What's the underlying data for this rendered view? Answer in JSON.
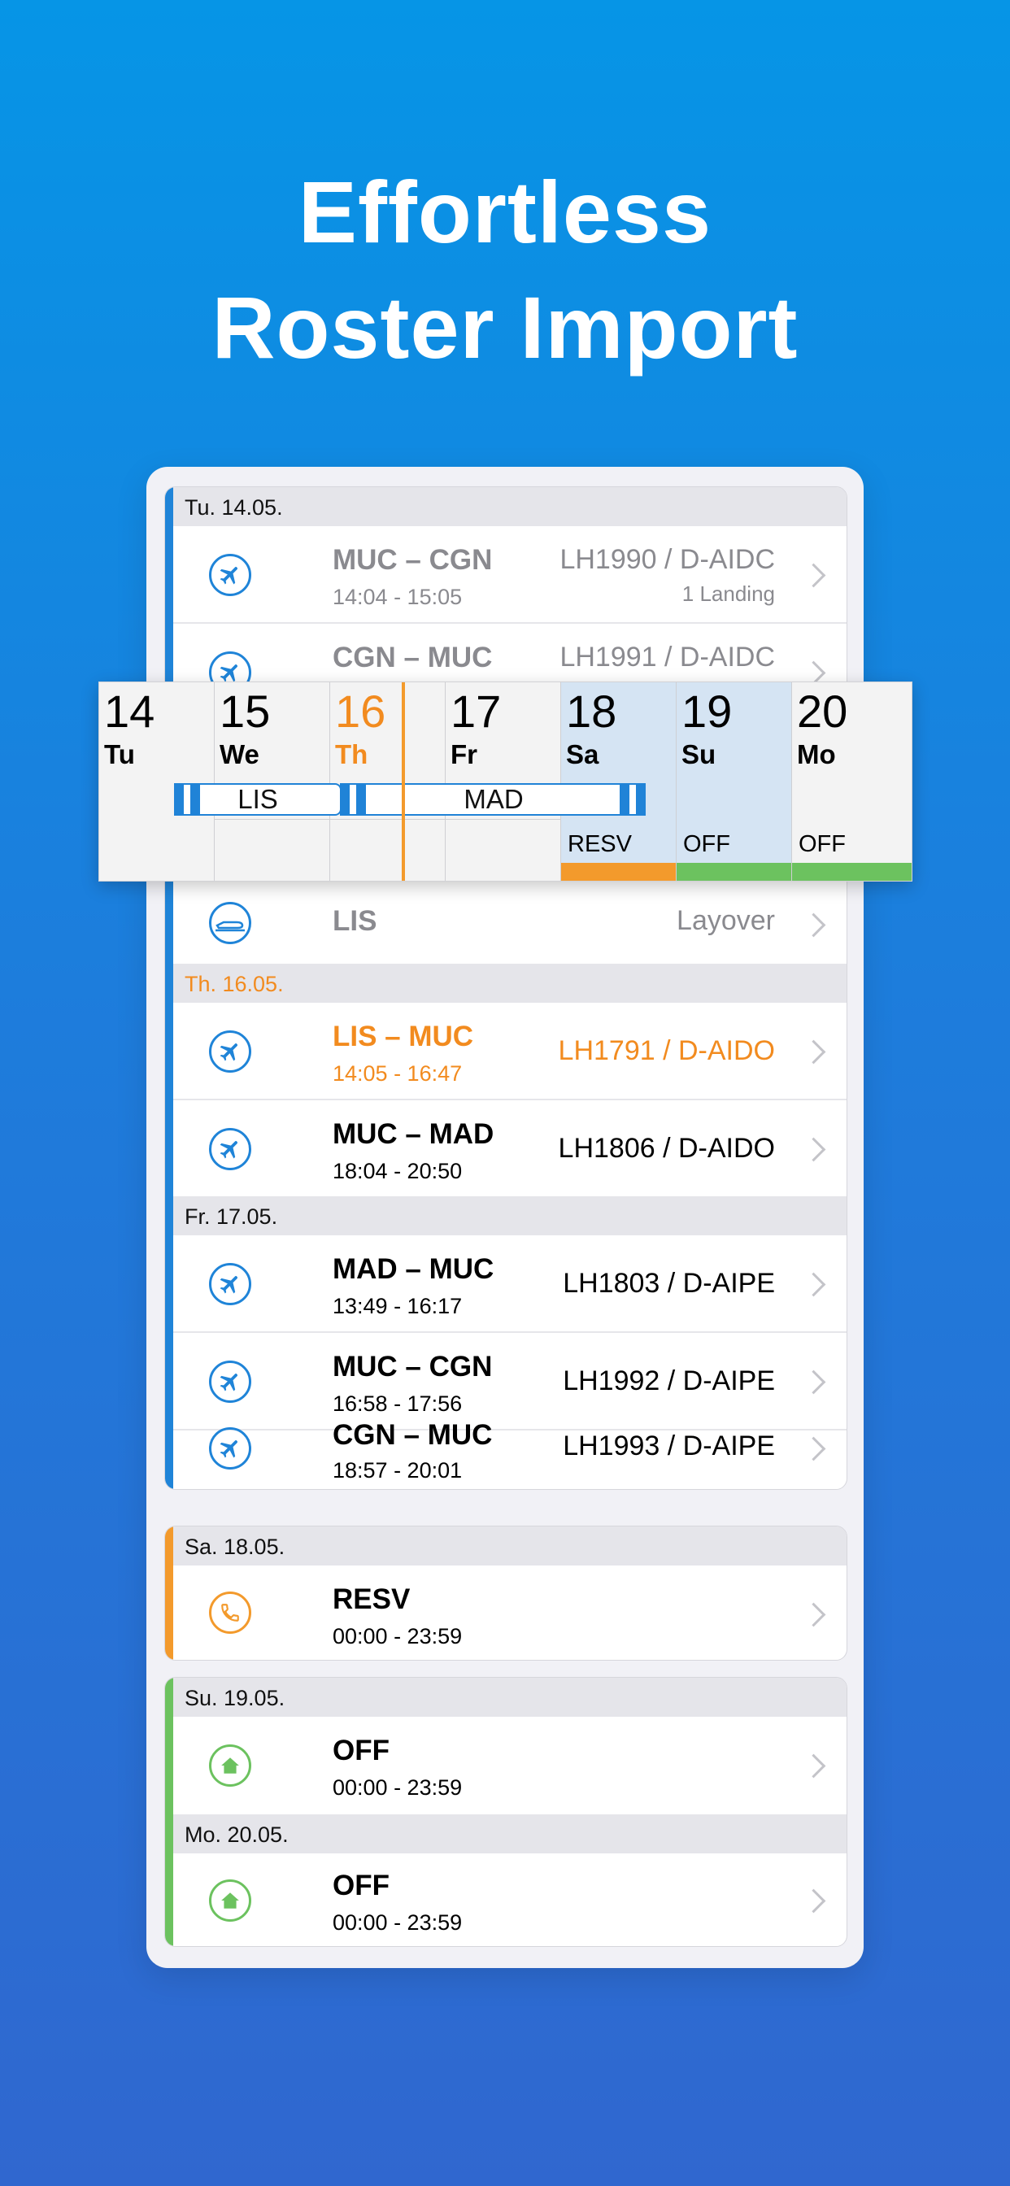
{
  "headline": {
    "line1": "Effortless",
    "line2": "Roster Import"
  },
  "colors": {
    "blue": "#1f84d8",
    "orange": "#f39a2c",
    "green": "#6cc25f"
  },
  "roster": {
    "tu_header": "Tu. 14.05.",
    "tu_rows": [
      {
        "route": "MUC – CGN",
        "time": "14:04 - 15:05",
        "flight": "LH1990 / D-AIDC",
        "note": "1 Landing",
        "icon": "airplane-icon"
      },
      {
        "route": "CGN – MUC",
        "flight": "LH1991 / D-AIDC",
        "icon": "airplane-icon"
      }
    ],
    "layover": {
      "place": "LIS",
      "label": "Layover",
      "icon": "layover-icon"
    },
    "th_header": "Th. 16.05.",
    "th_rows": [
      {
        "route": "LIS – MUC",
        "time": "14:05 - 16:47",
        "flight": "LH1791 / D-AIDO",
        "icon": "airplane-icon"
      },
      {
        "route": "MUC – MAD",
        "time": "18:04 - 20:50",
        "flight": "LH1806 / D-AIDO",
        "icon": "airplane-icon"
      }
    ],
    "fr_header": "Fr. 17.05.",
    "fr_rows": [
      {
        "route": "MAD – MUC",
        "time": "13:49 - 16:17",
        "flight": "LH1803 / D-AIPE",
        "icon": "airplane-icon"
      },
      {
        "route": "MUC – CGN",
        "time": "16:58 - 17:56",
        "flight": "LH1992 / D-AIPE",
        "icon": "airplane-icon"
      },
      {
        "route": "CGN – MUC",
        "time": "18:57 - 20:01",
        "flight": "LH1993 / D-AIPE",
        "icon": "airplane-icon"
      }
    ],
    "sa_header": "Sa. 18.05.",
    "sa_row": {
      "title": "RESV",
      "time": "00:00 - 23:59",
      "icon": "phone-icon"
    },
    "su_header": "Su. 19.05.",
    "su_row": {
      "title": "OFF",
      "time": "00:00 - 23:59",
      "icon": "home-icon"
    },
    "mo_header": "Mo. 20.05.",
    "mo_row": {
      "title": "OFF",
      "time": "00:00 - 23:59",
      "icon": "home-icon"
    }
  },
  "calendar": {
    "days": [
      {
        "num": "14",
        "wd": "Tu",
        "duty": ""
      },
      {
        "num": "15",
        "wd": "We",
        "duty": ""
      },
      {
        "num": "16",
        "wd": "Th",
        "duty": "",
        "today": true
      },
      {
        "num": "17",
        "wd": "Fr",
        "duty": ""
      },
      {
        "num": "18",
        "wd": "Sa",
        "duty": "RESV"
      },
      {
        "num": "19",
        "wd": "Su",
        "duty": "OFF"
      },
      {
        "num": "20",
        "wd": "Mo",
        "duty": "OFF"
      }
    ],
    "trips": [
      "LIS",
      "MAD"
    ]
  }
}
